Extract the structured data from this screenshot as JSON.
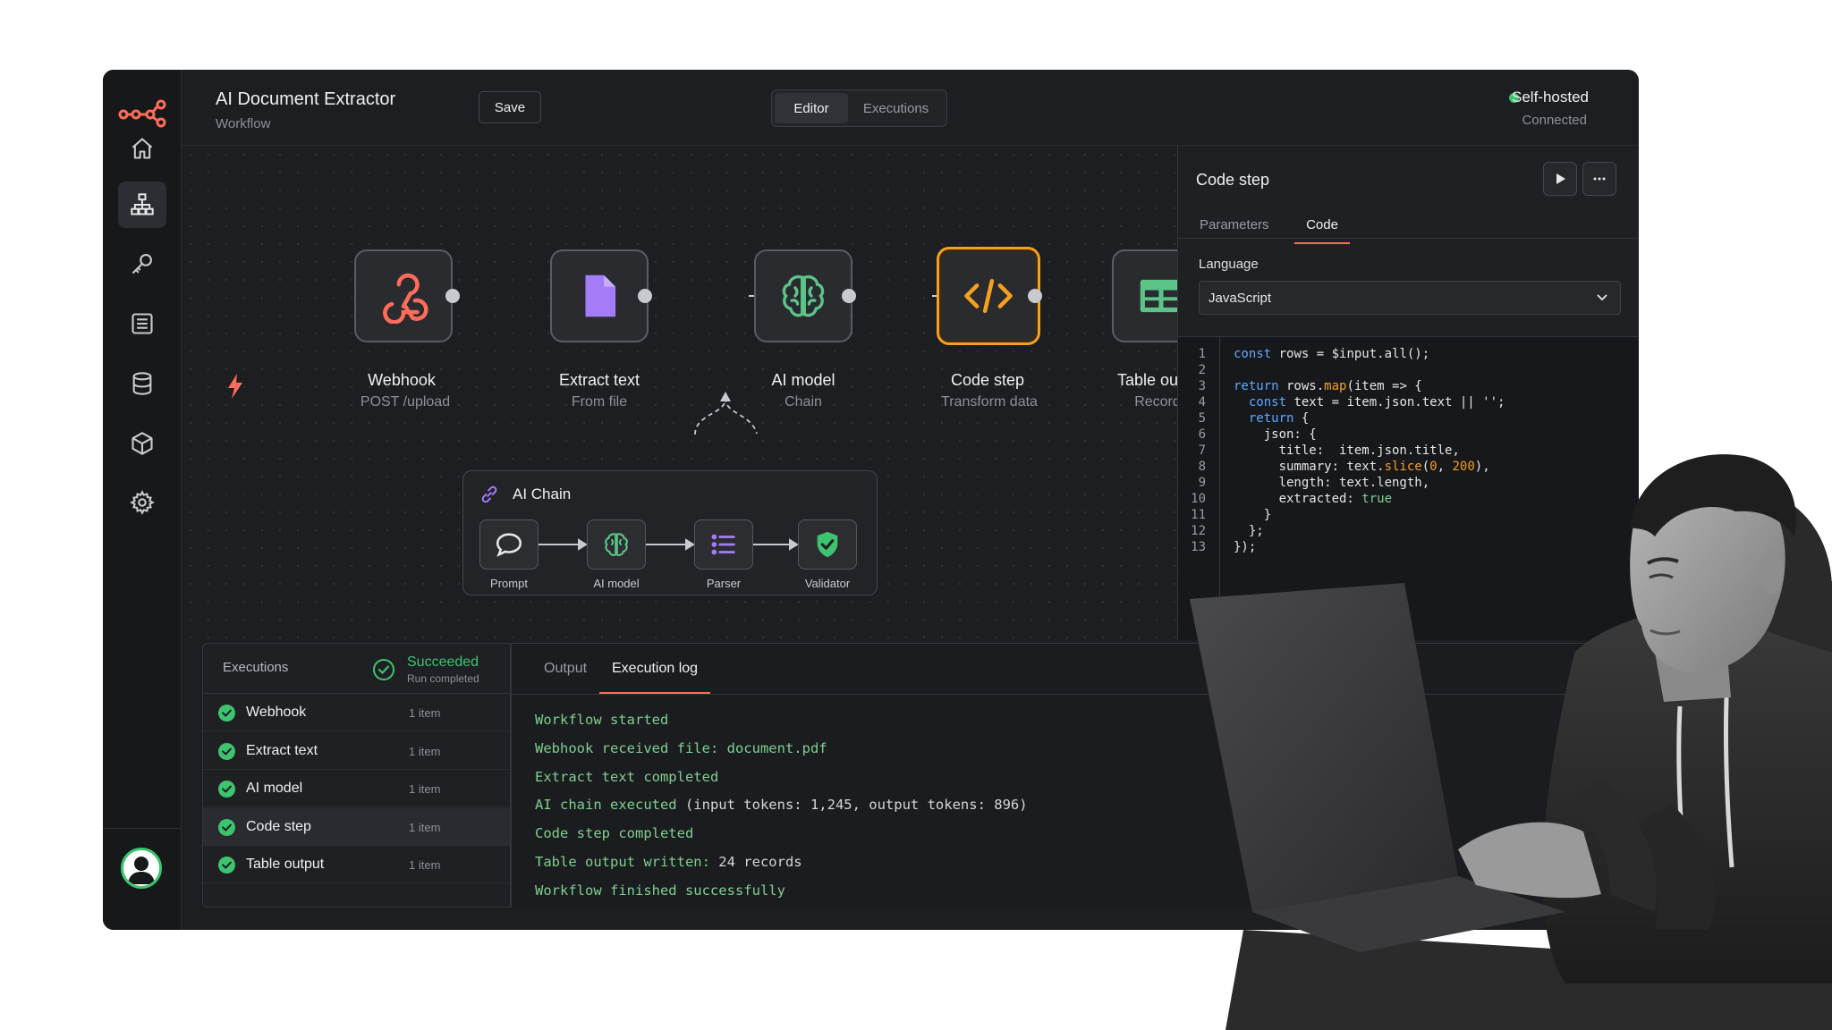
{
  "header": {
    "title": "AI Document Extractor",
    "subtitle": "Workflow",
    "save_label": "Save",
    "tabs": [
      {
        "label": "Editor",
        "active": true
      },
      {
        "label": "Executions",
        "active": false
      }
    ],
    "status": {
      "label": "Self-hosted",
      "sub": "Connected",
      "color": "#3dc46f"
    }
  },
  "sidebar": {
    "items": [
      {
        "icon": "home-icon"
      },
      {
        "icon": "workflow-icon",
        "active": true
      },
      {
        "icon": "key-icon"
      },
      {
        "icon": "list-icon"
      },
      {
        "icon": "database-icon"
      },
      {
        "icon": "cube-icon"
      },
      {
        "icon": "gear-icon"
      }
    ]
  },
  "nodes": [
    {
      "label": "Webhook",
      "sub": "POST /upload",
      "icon": "webhook-icon"
    },
    {
      "label": "Extract text",
      "sub": "From file",
      "icon": "file-icon"
    },
    {
      "label": "AI model",
      "sub": "Chain",
      "icon": "brain-icon"
    },
    {
      "label": "Code step",
      "sub": "Transform data",
      "icon": "code-icon",
      "selected": true
    },
    {
      "label": "Table output",
      "sub": "Records",
      "icon": "table-icon"
    }
  ],
  "chain": {
    "title": "AI Chain",
    "items": [
      {
        "label": "Prompt",
        "icon": "chat-icon"
      },
      {
        "label": "AI model",
        "icon": "brain-icon"
      },
      {
        "label": "Parser",
        "icon": "list-icon"
      },
      {
        "label": "Validator",
        "icon": "shield-check-icon"
      }
    ]
  },
  "panel": {
    "title": "Code step",
    "tabs": [
      {
        "label": "Parameters",
        "active": false
      },
      {
        "label": "Code",
        "active": true
      }
    ],
    "language_label": "Language",
    "language_value": "JavaScript",
    "code_lines": [
      "const rows = $input.all();",
      "",
      "return rows.map(item => {",
      "  const text = item.json.text || '';",
      "  return {",
      "    json: {",
      "      title:  item.json.title,",
      "      summary: text.slice(0, 200),",
      "      length: text.length,",
      "      extracted: true",
      "    }",
      "  };",
      "});"
    ]
  },
  "executions": {
    "title": "Executions",
    "status": "Succeeded",
    "status_sub": "Run completed",
    "rows": [
      {
        "name": "Webhook",
        "count": "1 item"
      },
      {
        "name": "Extract text",
        "count": "1 item"
      },
      {
        "name": "AI model",
        "count": "1 item"
      },
      {
        "name": "Code step",
        "count": "1 item",
        "active": true
      },
      {
        "name": "Table output",
        "count": "1 item"
      }
    ]
  },
  "log": {
    "tabs": [
      {
        "label": "Output",
        "active": false
      },
      {
        "label": "Execution log",
        "active": true
      }
    ],
    "lines": [
      {
        "text": "Workflow started",
        "rest": ""
      },
      {
        "text": "Webhook received file: document.pdf",
        "rest": ""
      },
      {
        "text": "Extract text completed",
        "rest": ""
      },
      {
        "text": "AI chain executed",
        "rest": " (input tokens: 1,245, output tokens: 896)"
      },
      {
        "text": "Code step completed",
        "rest": ""
      },
      {
        "text": "Table output written:",
        "rest": " 24 records"
      },
      {
        "text": "Workflow finished successfully",
        "rest": ""
      }
    ]
  },
  "colors": {
    "accent": "#ff6d5a",
    "selected": "#f6a021",
    "success": "#3dc46f"
  }
}
